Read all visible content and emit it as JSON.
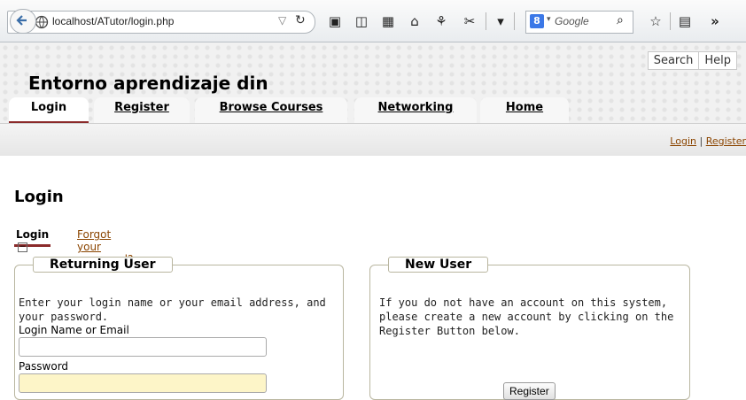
{
  "browser": {
    "url": "localhost/ATutor/login.php",
    "search_placeholder": "Google",
    "icons": [
      "back-icon",
      "globe-icon",
      "dropdown-icon",
      "reload-icon",
      "reader-icon",
      "sidebar-icon",
      "apps-icon",
      "home-icon",
      "share-icon",
      "bookmark-icon",
      "google-search-icon",
      "search-icon",
      "star-icon",
      "clipboard-icon",
      "overflow-icon"
    ]
  },
  "site": {
    "title": "Entorno aprendizaje din",
    "toplinks": {
      "search": "Search",
      "help": "Help"
    },
    "tabs": [
      {
        "label": "Login",
        "active": true
      },
      {
        "label": "Register"
      },
      {
        "label": "Browse Courses"
      },
      {
        "label": "Networking"
      },
      {
        "label": "Home"
      }
    ],
    "sublinks": {
      "login": "Login",
      "sep": "|",
      "register": "Register"
    }
  },
  "page": {
    "title": "Login",
    "subtabs": {
      "login": "Login",
      "toggle": "−",
      "forgot": "Forgot your password?"
    },
    "returning": {
      "legend": "Returning User",
      "intro": "Enter your login name or your email address, and your password.",
      "login_label": "Login Name or Email",
      "login_value": "",
      "password_label": "Password",
      "password_value": ""
    },
    "newuser": {
      "legend": "New User",
      "text": "If you do not have an account on this system, please create a new account by clicking on the Register Button below.",
      "button": "Register"
    }
  },
  "colors": {
    "tab_accent": "#8b2a2a",
    "link": "#8b4500",
    "password_bg": "#fdf5c8"
  }
}
